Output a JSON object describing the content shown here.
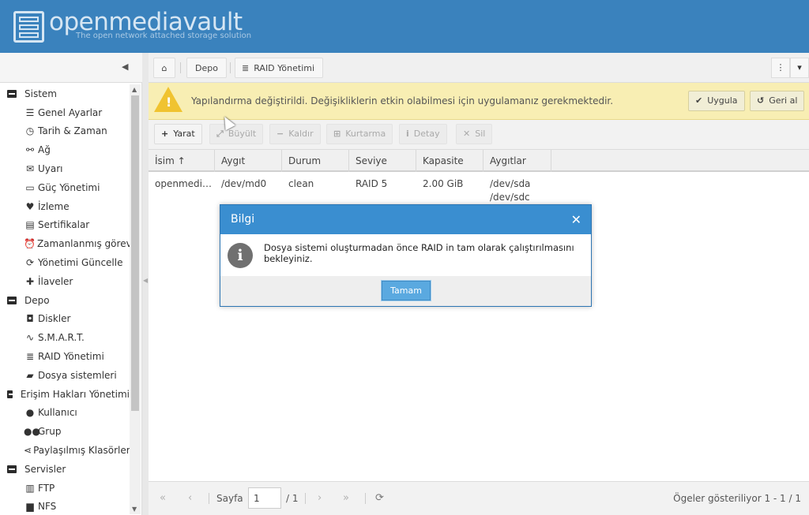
{
  "app": {
    "logo_text": "openmediavault",
    "tagline": "The open network attached storage solution"
  },
  "sidebar": {
    "groups": [
      {
        "label": "Sistem",
        "items": [
          {
            "label": "Genel Ayarlar",
            "icon": "sliders-icon"
          },
          {
            "label": "Tarih & Zaman",
            "icon": "clock-icon"
          },
          {
            "label": "Ağ",
            "icon": "network-icon"
          },
          {
            "label": "Uyarı",
            "icon": "envelope-icon"
          },
          {
            "label": "Güç Yönetimi",
            "icon": "battery-icon"
          },
          {
            "label": "İzleme",
            "icon": "heartbeat-icon"
          },
          {
            "label": "Sertifikalar",
            "icon": "certificate-icon"
          },
          {
            "label": "Zamanlanmış görevler",
            "icon": "alarm-clock-icon"
          },
          {
            "label": "Yönetimi Güncelle",
            "icon": "refresh-icon"
          },
          {
            "label": "İlaveler",
            "icon": "puzzle-icon"
          }
        ]
      },
      {
        "label": "Depo",
        "items": [
          {
            "label": "Diskler",
            "icon": "disk-icon"
          },
          {
            "label": "S.M.A.R.T.",
            "icon": "pulse-icon"
          },
          {
            "label": "RAID Yönetimi",
            "icon": "database-icon"
          },
          {
            "label": "Dosya sistemleri",
            "icon": "folder-icon"
          }
        ]
      },
      {
        "label": "Erişim Hakları Yönetimi",
        "items": [
          {
            "label": "Kullanıcı",
            "icon": "user-icon"
          },
          {
            "label": "Grup",
            "icon": "users-icon"
          },
          {
            "label": "Paylaşılmış Klasörler",
            "icon": "share-icon"
          }
        ]
      },
      {
        "label": "Servisler",
        "items": [
          {
            "label": "FTP",
            "icon": "server-icon"
          },
          {
            "label": "NFS",
            "icon": "desktop-icon"
          }
        ]
      }
    ]
  },
  "breadcrumb": {
    "home_icon": "home-icon",
    "depo": "Depo",
    "raid": "RAID Yönetimi"
  },
  "warning": {
    "message": "Yapılandırma değiştirildi. Değişikliklerin etkin olabilmesi için uygulamanız gerekmektedir.",
    "apply_label": "Uygula",
    "revert_label": "Geri al"
  },
  "toolbar": {
    "create": "Yarat",
    "grow": "Büyült",
    "remove": "Kaldır",
    "recover": "Kurtarma",
    "detail": "Detay",
    "delete": "Sil"
  },
  "grid": {
    "columns": [
      "İsim",
      "Aygıt",
      "Durum",
      "Seviye",
      "Kapasite",
      "Aygıtlar"
    ],
    "rows": [
      {
        "name": "openmedi…",
        "device": "/dev/md0",
        "state": "clean",
        "level": "RAID 5",
        "capacity": "2.00 GiB",
        "devices_line1": "/dev/sda",
        "devices_line2": "/dev/sdc"
      }
    ]
  },
  "pager": {
    "page_label": "Sayfa",
    "page_value": "1",
    "page_total": "/ 1",
    "status": "Ögeler gösteriliyor 1 - 1 / 1"
  },
  "dialog": {
    "title": "Bilgi",
    "message": "Dosya sistemi oluşturmadan önce RAID in tam olarak çalıştırılmasını bekleyiniz.",
    "ok_label": "Tamam"
  },
  "colors": {
    "header": "#3a82bd",
    "warning_bg": "#f8eeb3",
    "dialog_header": "#3a8ed0",
    "ok_button": "#5aa9e0"
  }
}
